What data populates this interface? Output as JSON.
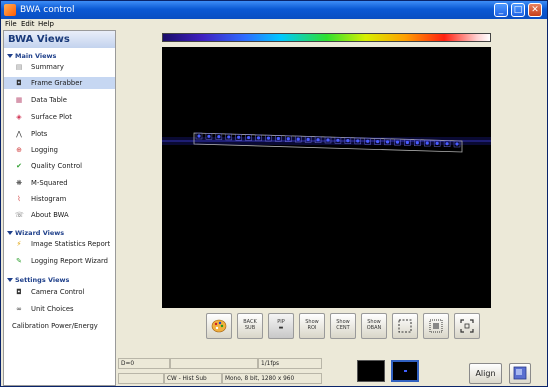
{
  "window": {
    "title": "BWA control"
  },
  "menu": [
    {
      "label": "File",
      "underline": "F"
    },
    {
      "label": "Edit",
      "underline": "E"
    },
    {
      "label": "Help",
      "underline": "H"
    }
  ],
  "sidebar": {
    "header": "BWA Views",
    "sections": [
      {
        "label": "Main Views",
        "items": [
          {
            "label": "Summary",
            "icon": "summary-icon"
          },
          {
            "label": "Frame Grabber",
            "icon": "camera-icon",
            "selected": true
          },
          {
            "label": "Data Table",
            "icon": "table-icon"
          },
          {
            "label": "Surface Plot",
            "icon": "surface-icon"
          },
          {
            "label": "Plots",
            "icon": "plot-icon"
          },
          {
            "label": "Logging",
            "icon": "logging-icon"
          },
          {
            "label": "Quality Control",
            "icon": "checkmark-icon"
          },
          {
            "label": "M-Squared",
            "icon": "msquared-icon"
          },
          {
            "label": "Histogram",
            "icon": "histogram-icon"
          },
          {
            "label": "About BWA",
            "icon": "about-icon"
          }
        ]
      },
      {
        "label": "Wizard Views",
        "items": [
          {
            "label": "Image Statistics Report",
            "icon": "wizard-icon"
          },
          {
            "label": "Logging Report Wizard",
            "icon": "pen-icon"
          }
        ]
      },
      {
        "label": "Settings Views",
        "items": [
          {
            "label": "Camera Control",
            "icon": "camera-icon"
          },
          {
            "label": "Unit Choices",
            "icon": "binoculars-icon"
          },
          {
            "label": "Calibration Power/Energy",
            "icon": ""
          }
        ]
      }
    ]
  },
  "toolbar": {
    "buttons": [
      {
        "label": "",
        "icon": "palette-icon"
      },
      {
        "label": "BACK\nSUB",
        "icon": ""
      },
      {
        "label": "PIP\n▬",
        "icon": ""
      },
      {
        "label": "Show\nROI",
        "icon": ""
      },
      {
        "label": "Show\nCENT",
        "icon": ""
      },
      {
        "label": "Show\nOBAN",
        "icon": ""
      },
      {
        "label": "",
        "icon": "roi-select-icon"
      },
      {
        "label": "",
        "icon": "pattern-icon"
      },
      {
        "label": "",
        "icon": "crop-icon"
      }
    ]
  },
  "status": {
    "d_value": "D=0",
    "fps": "1/1fps",
    "mode": "CW - Hist Sub",
    "format": "Mono, 8 bit, 1280 x 960",
    "align_label": "Align"
  },
  "image": {
    "beam_spots": 27
  }
}
